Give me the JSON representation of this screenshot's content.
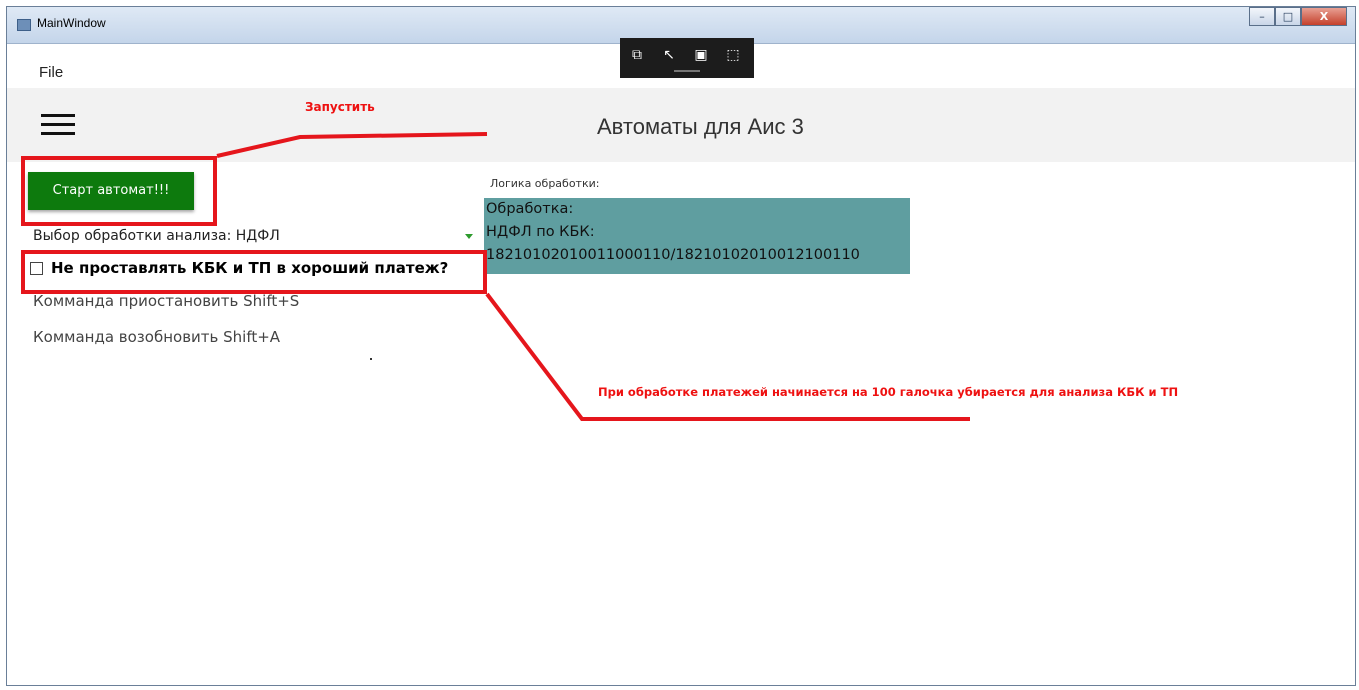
{
  "window": {
    "title": "MainWindow",
    "controls": {
      "minimize": "–",
      "maximize": "□",
      "close": "X"
    }
  },
  "menu": {
    "file_label": "File"
  },
  "header": {
    "title": "Автоматы для Аис 3",
    "menu_icon": "hamburger-icon"
  },
  "debug_toolbar": {
    "icons": [
      "select-visual-icon",
      "pointer-icon",
      "display-layout-icon",
      "track-focus-icon"
    ]
  },
  "main": {
    "start_button_label": "Старт автомат!!!",
    "analysis_select": {
      "label": "Выбор обработки анализа: ",
      "value": "НДФЛ"
    },
    "checkbox": {
      "label": "Не проставлять КБК и ТП в хороший платеж?",
      "checked": false
    },
    "commands": [
      "Комманда приостановить Shift+S",
      "Комманда возобновить Shift+A"
    ],
    "logic": {
      "caption": "Логика обработки:",
      "lines": [
        "Обработка:",
        "НДФЛ по КБК:",
        "18210102010011000110/18210102010012100110"
      ]
    }
  },
  "annotations": {
    "run_label": "Запустить",
    "note": "При обработке платежей начинается на 100 галочка убирается для анализа КБК и ТП",
    "color": "#e5161c"
  },
  "colors": {
    "start_button": "#0d7a0d",
    "logic_box": "#5f9ea0",
    "header_bg": "#f2f2f2"
  }
}
